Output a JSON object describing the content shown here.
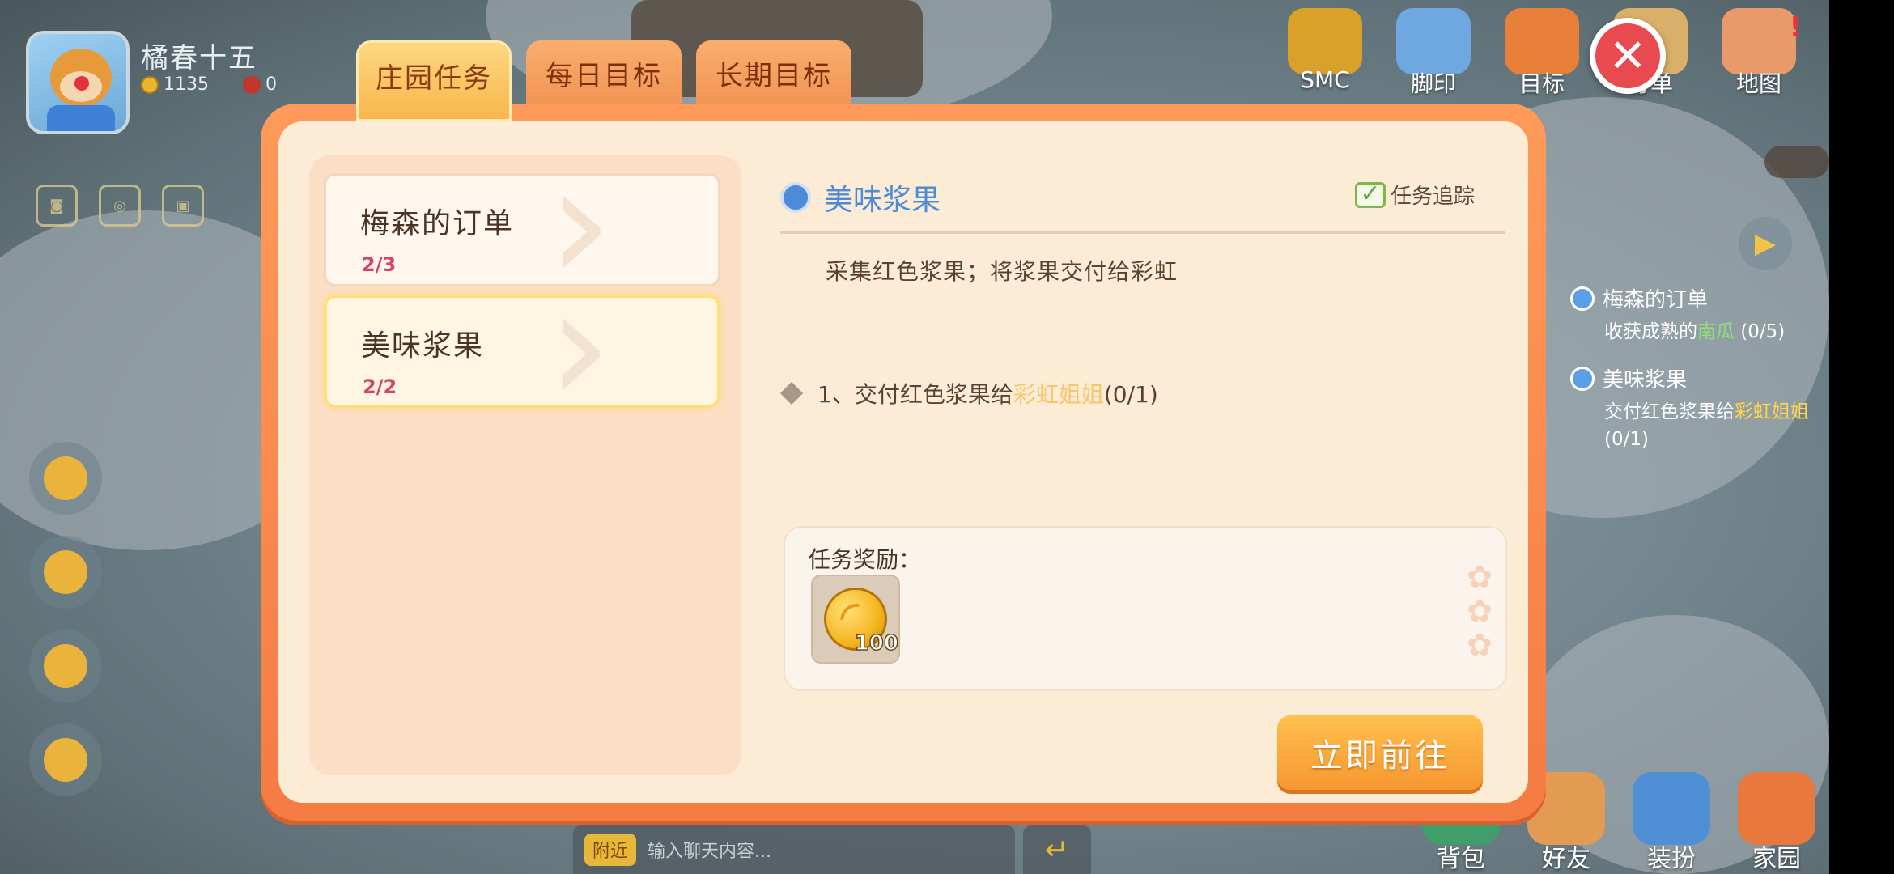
{
  "player": {
    "name": "橘春十五",
    "coins": "1135",
    "beans": "0"
  },
  "top_nav": [
    {
      "label": "SMC",
      "icon": "smc-badge-icon",
      "color": "#d9a02a"
    },
    {
      "label": "脚印",
      "icon": "paw-print-icon",
      "color": "#6fa8e0"
    },
    {
      "label": "目标",
      "icon": "goal-book-icon",
      "color": "#e9803a"
    },
    {
      "label": "订单",
      "icon": "order-clipboard-icon",
      "color": "#d9b06a"
    },
    {
      "label": "地图",
      "icon": "castle-map-icon",
      "color": "#e89a6a"
    }
  ],
  "top_nav_badge": "!",
  "tabs": [
    {
      "label": "庄园任务",
      "active": true
    },
    {
      "label": "每日目标",
      "active": false
    },
    {
      "label": "长期目标",
      "active": false
    }
  ],
  "task_list": [
    {
      "name": "梅森的订单",
      "progress": "2/3",
      "selected": false
    },
    {
      "name": "美味浆果",
      "progress": "2/2",
      "selected": true
    }
  ],
  "detail": {
    "title": "美味浆果",
    "track_label": "任务追踪",
    "description": "采集红色浆果；将浆果交付给彩虹",
    "objective_prefix": "1、交付红色浆果给",
    "objective_target": "彩虹姐姐",
    "objective_count": "(0/1)",
    "reward_label": "任务奖励：",
    "reward_quantity": "100",
    "go_button": "立即前往"
  },
  "tracker": [
    {
      "title": "梅森的订单",
      "desc_prefix": "收获成熟的",
      "desc_highlight": "南瓜",
      "desc_suffix": " (0/5)"
    },
    {
      "title": "美味浆果",
      "desc_prefix": "交付红色浆果给",
      "desc_highlight": "彩虹姐姐",
      "desc_suffix": " (0/1)"
    }
  ],
  "chat": {
    "channel": "附近",
    "placeholder": "输入聊天内容..."
  },
  "bottom_nav": [
    {
      "label": "背包",
      "icon": "backpack-icon"
    },
    {
      "label": "好友",
      "icon": "friends-icon"
    },
    {
      "label": "装扮",
      "icon": "wardrobe-icon"
    },
    {
      "label": "家园",
      "icon": "home-icon"
    }
  ],
  "colors": {
    "accent_orange": "#f57b42",
    "panel_bg": "#fcecd6",
    "title_blue": "#4c8bd8",
    "progress_pink": "#d2466a",
    "highlight_yellow": "#f6c56f"
  }
}
